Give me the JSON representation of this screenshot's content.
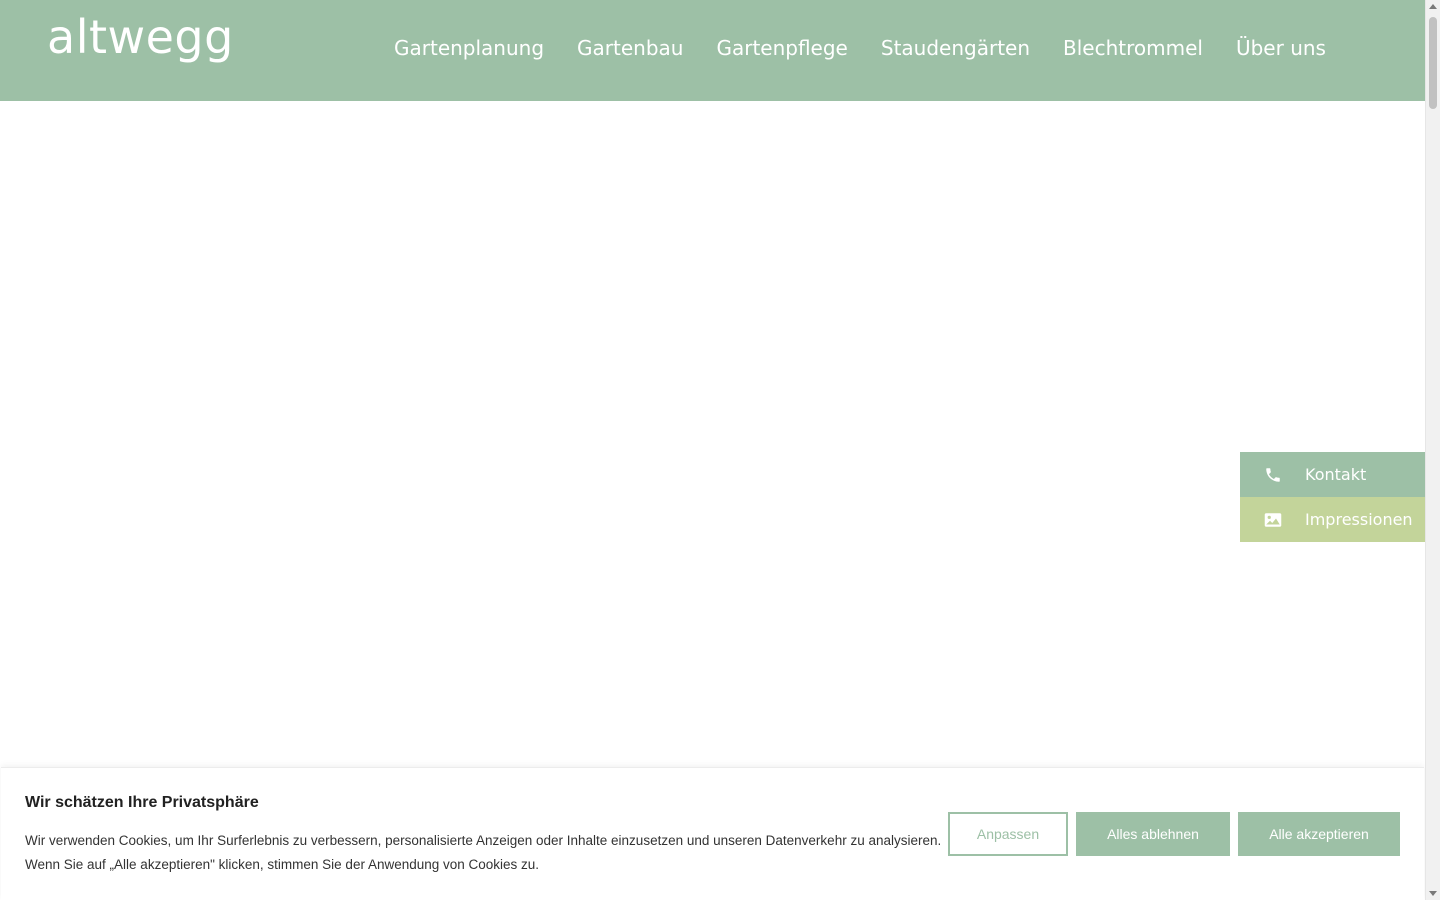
{
  "header": {
    "logo": "altwegg",
    "nav": [
      {
        "label": "Gartenplanung"
      },
      {
        "label": "Gartenbau"
      },
      {
        "label": "Gartenpflege"
      },
      {
        "label": "Staudengärten"
      },
      {
        "label": "Blechtrommel"
      },
      {
        "label": "Über uns"
      }
    ]
  },
  "side_widget": {
    "items": [
      {
        "label": "Kontakt",
        "icon": "phone-icon"
      },
      {
        "label": "Impressionen",
        "icon": "image-icon"
      }
    ]
  },
  "cookie_banner": {
    "title": "Wir schätzen Ihre Privatsphäre",
    "text_line1": "Wir verwenden Cookies, um Ihr Surferlebnis zu verbessern, personalisierte Anzeigen oder Inhalte einzusetzen und unseren Datenverkehr zu analysieren.",
    "text_line2": "Wenn Sie auf „Alle akzeptieren\" klicken, stimmen Sie der Anwendung von Cookies zu.",
    "buttons": {
      "customize": "Anpassen",
      "reject_all": "Alles ablehnen",
      "accept_all": "Alle akzeptieren"
    }
  },
  "colors": {
    "primary_green": "#9dc0a6",
    "secondary_green": "#c3d49a",
    "white": "#ffffff"
  }
}
